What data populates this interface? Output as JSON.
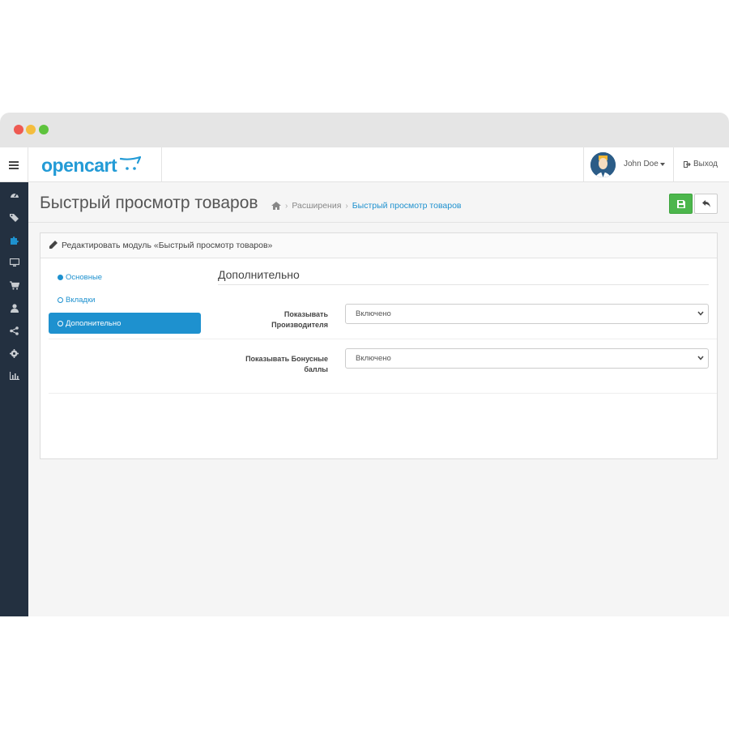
{
  "header": {
    "logo_text": "opencart",
    "user_name": "John Doe",
    "logout_label": "Выход"
  },
  "sidebar": {
    "icons": [
      "dashboard-icon",
      "tags-icon",
      "puzzle-icon",
      "desktop-icon",
      "cart-icon",
      "user-icon",
      "share-icon",
      "cog-icon",
      "bar-chart-icon"
    ],
    "active_index": 2
  },
  "page": {
    "title": "Быстрый просмотр товаров",
    "breadcrumb": [
      "Расширения",
      "Быстрый просмотр товаров"
    ]
  },
  "panel": {
    "heading": "Редактировать модуль «Быстрый просмотр товаров»",
    "tabs": [
      {
        "label": "Основные"
      },
      {
        "label": "Вкладки"
      },
      {
        "label": "Дополнительно"
      }
    ],
    "section_title": "Дополнительно",
    "fields": [
      {
        "label_line1": "Показывать",
        "label_line2": "Производителя",
        "value": "Включено"
      },
      {
        "label_line1": "Показывать Бонусные",
        "label_line2": "баллы",
        "value": "Включено"
      }
    ]
  },
  "colors": {
    "accent": "#1e91cf",
    "sidebar_bg": "#233040",
    "save_green": "#4cb64c"
  }
}
